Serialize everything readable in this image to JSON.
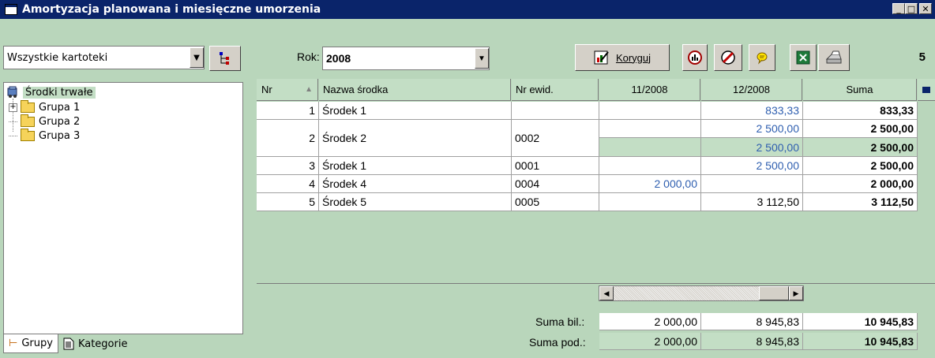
{
  "window": {
    "title": "Amortyzacja planowana i miesięczne umorzenia"
  },
  "left": {
    "filter_value": "Wszystkie kartoteki",
    "tree": {
      "root": "Środki trwałe",
      "items": [
        "Grupa 1",
        "Grupa 2",
        "Grupa 3"
      ]
    },
    "tabs": [
      "Grupy",
      "Kategorie"
    ]
  },
  "toolbar": {
    "rok_label": "Rok:",
    "rok_value": "2008",
    "koryguj_label": "Koryguj",
    "count": "5"
  },
  "grid": {
    "headers": [
      "Nr",
      "Nazwa środka",
      "Nr ewid.",
      "11/2008",
      "12/2008",
      "Suma"
    ],
    "rows": [
      {
        "nr": "1",
        "nazwa": "Środek 1",
        "ewid": "",
        "m11": "",
        "m12": "833,33",
        "suma": "833,33"
      },
      {
        "nr": "2",
        "nazwa": "Środek 2",
        "ewid": "0002",
        "m11": "",
        "m12": "2 500,00",
        "suma": "2 500,00",
        "m12b": "2 500,00",
        "sumab": "2 500,00"
      },
      {
        "nr": "3",
        "nazwa": "Środek 1",
        "ewid": "0001",
        "m11": "",
        "m12": "2 500,00",
        "suma": "2 500,00"
      },
      {
        "nr": "4",
        "nazwa": "Środek 4",
        "ewid": "0004",
        "m11": "2 000,00",
        "m12": "",
        "suma": "2 000,00"
      },
      {
        "nr": "5",
        "nazwa": "Środek 5",
        "ewid": "0005",
        "m11": "",
        "m12": "3 112,50",
        "suma": "3 112,50"
      }
    ],
    "totals": [
      {
        "label": "Suma bil.:",
        "m11": "2 000,00",
        "m12": "8 945,83",
        "suma": "10 945,83"
      },
      {
        "label": "Suma pod.:",
        "m11": "2 000,00",
        "m12": "8 945,83",
        "suma": "10 945,83"
      }
    ]
  }
}
